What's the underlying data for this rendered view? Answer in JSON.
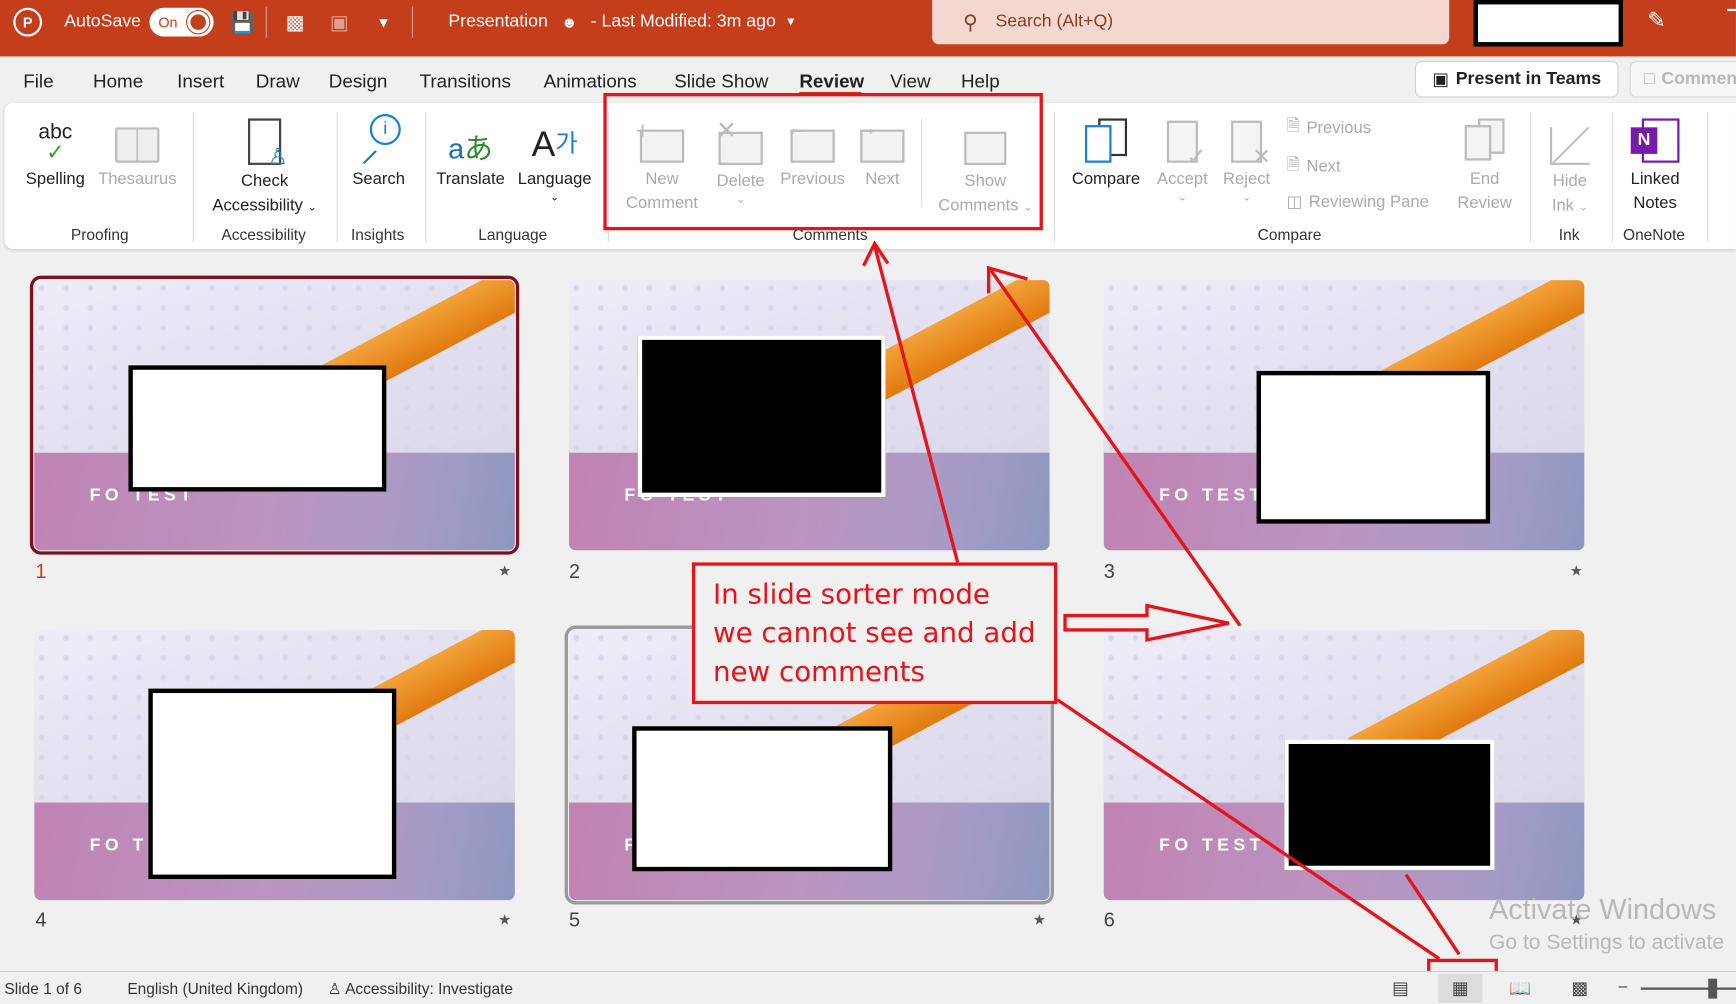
{
  "titlebar": {
    "autosave_label": "AutoSave",
    "autosave_state": "On",
    "document_title": "Presentation",
    "last_modified": "- Last Modified: 3m ago",
    "search_placeholder": "Search (Alt+Q)",
    "brand_color": "#c43e1c"
  },
  "menu": {
    "tabs": [
      "File",
      "Home",
      "Insert",
      "Draw",
      "Design",
      "Transitions",
      "Animations",
      "Slide Show",
      "Review",
      "View",
      "Help"
    ],
    "active_tab": "Review",
    "present_in_teams": "Present in Teams",
    "comments": "Comments"
  },
  "ribbon": {
    "proofing": {
      "label": "Proofing",
      "spelling": "Spelling",
      "thesaurus": "Thesaurus"
    },
    "accessibility": {
      "label": "Accessibility",
      "check_line1": "Check",
      "check_line2": "Accessibility"
    },
    "insights": {
      "label": "Insights",
      "search": "Search"
    },
    "language": {
      "label": "Language",
      "translate": "Translate",
      "language": "Language"
    },
    "comments": {
      "label": "Comments",
      "new_line1": "New",
      "new_line2": "Comment",
      "delete": "Delete",
      "previous": "Previous",
      "next": "Next",
      "show_line1": "Show",
      "show_line2": "Comments"
    },
    "compare": {
      "label": "Compare",
      "compare": "Compare",
      "accept": "Accept",
      "reject": "Reject",
      "previous": "Previous",
      "next": "Next",
      "reviewing_pane": "Reviewing Pane",
      "end_line1": "End",
      "end_line2": "Review"
    },
    "ink": {
      "label": "Ink",
      "hide_line1": "Hide",
      "hide_line2": "Ink"
    },
    "onenote": {
      "label": "OneNote",
      "linked_line1": "Linked",
      "linked_line2": "Notes"
    }
  },
  "slides": [
    {
      "number": "1",
      "title": "FO TEST",
      "selected": true
    },
    {
      "number": "2",
      "title": "FO TEST",
      "selected": false
    },
    {
      "number": "3",
      "title": "FO TEST",
      "selected": false
    },
    {
      "number": "4",
      "title": "FO TEST",
      "selected": false
    },
    {
      "number": "5",
      "title": "FO TEST",
      "selected": false
    },
    {
      "number": "6",
      "title": "FO TEST",
      "selected": false
    }
  ],
  "annotation": {
    "text": "In slide sorter mode we cannot see and add  new comments",
    "color": "#e4141b"
  },
  "watermark": {
    "line1": "Activate Windows",
    "line2": "Go to Settings to activate"
  },
  "statusbar": {
    "slide_info": "Slide 1 of 6",
    "language": "English (United Kingdom)",
    "accessibility": "Accessibility: Investigate",
    "active_view": "Slide Sorter"
  }
}
